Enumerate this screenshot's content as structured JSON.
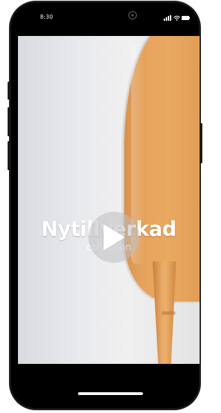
{
  "status_bar": {
    "time": "8:30",
    "signal_icon": "signal-icon",
    "wifi_icon": "wifi-icon",
    "battery_icon": "battery-icon",
    "camera_icon": "camera-icon"
  },
  "media": {
    "title": "Nytillverkad",
    "subtitle": "collection",
    "play_icon": "play-icon"
  },
  "colors": {
    "screen_background": "#000000",
    "wall": "#e5e6ea",
    "wood": "#e6a35c",
    "text": "#ffffff"
  }
}
